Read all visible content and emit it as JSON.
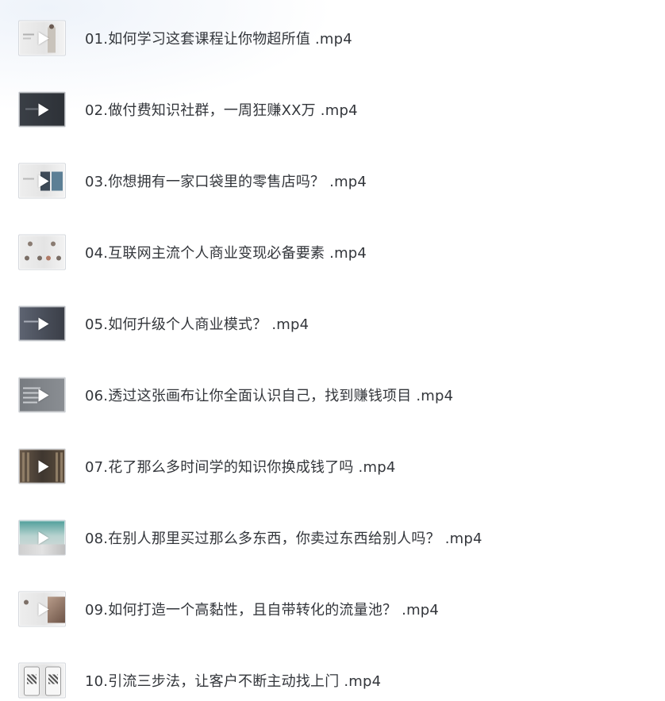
{
  "files": [
    {
      "name": "01.如何学习这套课程让你物超所值 .mp4",
      "thumb": "light"
    },
    {
      "name": "02.做付费知识社群，一周狂赚XX万 .mp4",
      "thumb": "dark"
    },
    {
      "name": "03.你想拥有一家口袋里的零售店吗？ .mp4",
      "thumb": "light"
    },
    {
      "name": "04.互联网主流个人商业变现必备要素 .mp4",
      "thumb": "light"
    },
    {
      "name": "05.如何升级个人商业模式？ .mp4",
      "thumb": "slate"
    },
    {
      "name": "06.透过这张画布让你全面认识自己，找到赚钱项目 .mp4",
      "thumb": "grey"
    },
    {
      "name": "07.花了那么多时间学的知识你换成钱了吗 .mp4",
      "thumb": "brown"
    },
    {
      "name": "08.在别人那里买过那么多东西，你卖过东西给别人吗？ .mp4",
      "thumb": "teal"
    },
    {
      "name": "09.如何打造一个高黏性，且自带转化的流量池？ .mp4",
      "thumb": "light"
    },
    {
      "name": "10.引流三步法，让客户不断主动找上门 .mp4",
      "thumb": "light"
    }
  ]
}
